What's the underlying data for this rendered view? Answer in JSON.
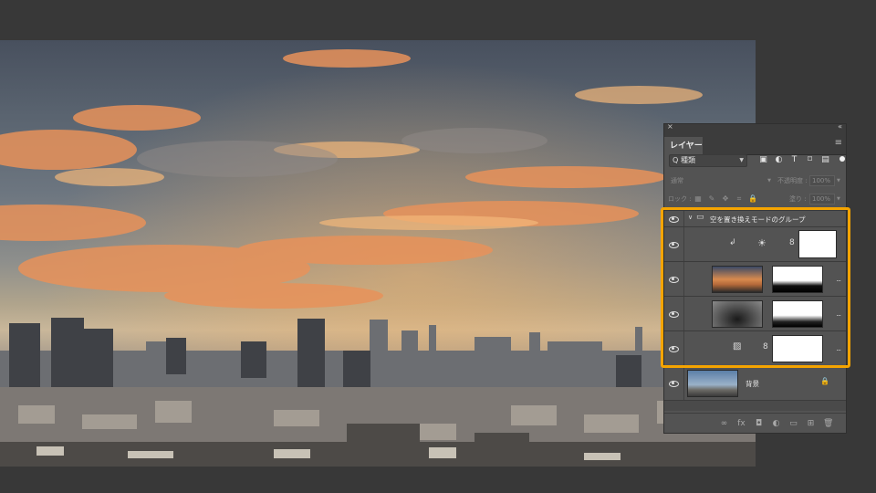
{
  "panel": {
    "close_glyph": "×",
    "collapse_glyph": "«",
    "tab_label": "レイヤー",
    "menu_icon": "panel-menu-icon",
    "filter": {
      "search_glyph": "Q",
      "kind_value": "種類",
      "icons": [
        "image-filter-icon",
        "adjustment-filter-icon",
        "type-filter-icon",
        "shape-filter-icon",
        "smart-object-filter-icon"
      ]
    },
    "blend_mode": "通常",
    "opacity_label": "不透明度 :",
    "opacity_value": "100%",
    "lock_label": "ロック :",
    "lock_icons": [
      "lock-transparency-icon",
      "lock-paint-icon",
      "lock-position-icon",
      "lock-artboard-icon",
      "lock-all-icon"
    ],
    "fill_label": "塗り :",
    "fill_value": "100%"
  },
  "layers": {
    "group_name": "空を置き換えモードのグループ",
    "background_name": "背景",
    "more_glyph": "...",
    "link_glyph": "8"
  },
  "bottom_icons": [
    "link-layers-icon",
    "fx-icon",
    "add-mask-icon",
    "new-fill-adjustment-icon",
    "new-group-icon",
    "new-layer-icon",
    "trash-icon"
  ],
  "bottom_glyphs": [
    "∞",
    "fx",
    "◘",
    "◐",
    "▭",
    "⊞",
    "🗑"
  ],
  "colors": {
    "highlight": "#f5a400",
    "panel_bg": "#535353",
    "app_bg": "#383838"
  }
}
